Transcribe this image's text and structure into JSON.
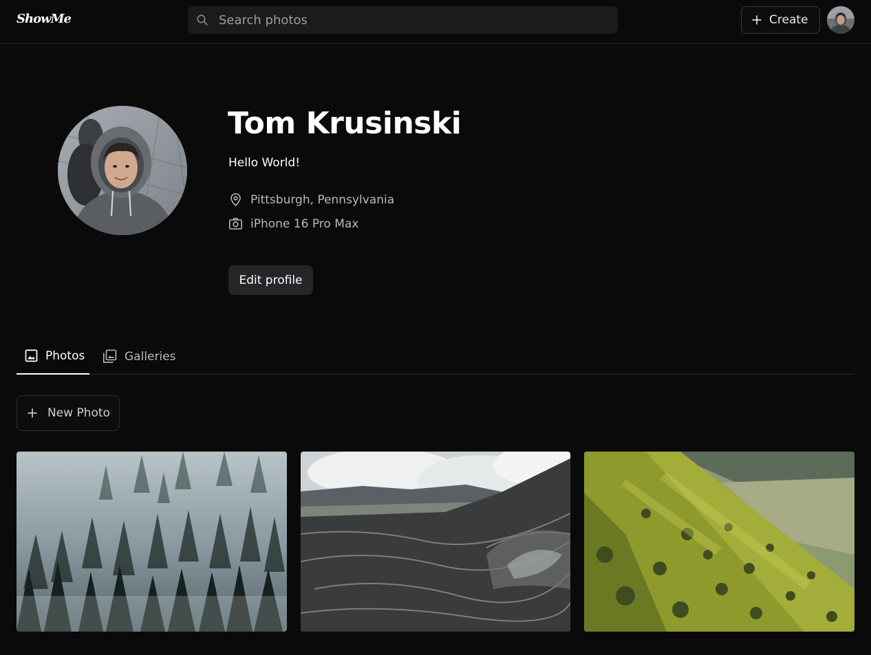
{
  "app": {
    "logo_text": "ShowMe"
  },
  "header": {
    "search_placeholder": "Search photos",
    "create_label": "Create"
  },
  "profile": {
    "name": "Tom Krusinski",
    "bio": "Hello World!",
    "location": "Pittsburgh, Pennsylvania",
    "camera": "iPhone 16 Pro Max",
    "edit_label": "Edit profile"
  },
  "tabs": [
    {
      "label": "Photos",
      "active": true,
      "icon": "image-icon"
    },
    {
      "label": "Galleries",
      "active": false,
      "icon": "gallery-stack-icon"
    }
  ],
  "actions": {
    "new_photo_label": "New Photo"
  },
  "photos": [
    {
      "subject": "misty pine forest on a hillside"
    },
    {
      "subject": "volcanic lava field under clouds"
    },
    {
      "subject": "green grassy hill slope and valley"
    }
  ],
  "colors": {
    "background": "#0a0a0b",
    "surface": "#1b1b1d",
    "button": "#26262a",
    "text_primary": "#ffffff",
    "text_secondary": "#b9b9bb"
  }
}
